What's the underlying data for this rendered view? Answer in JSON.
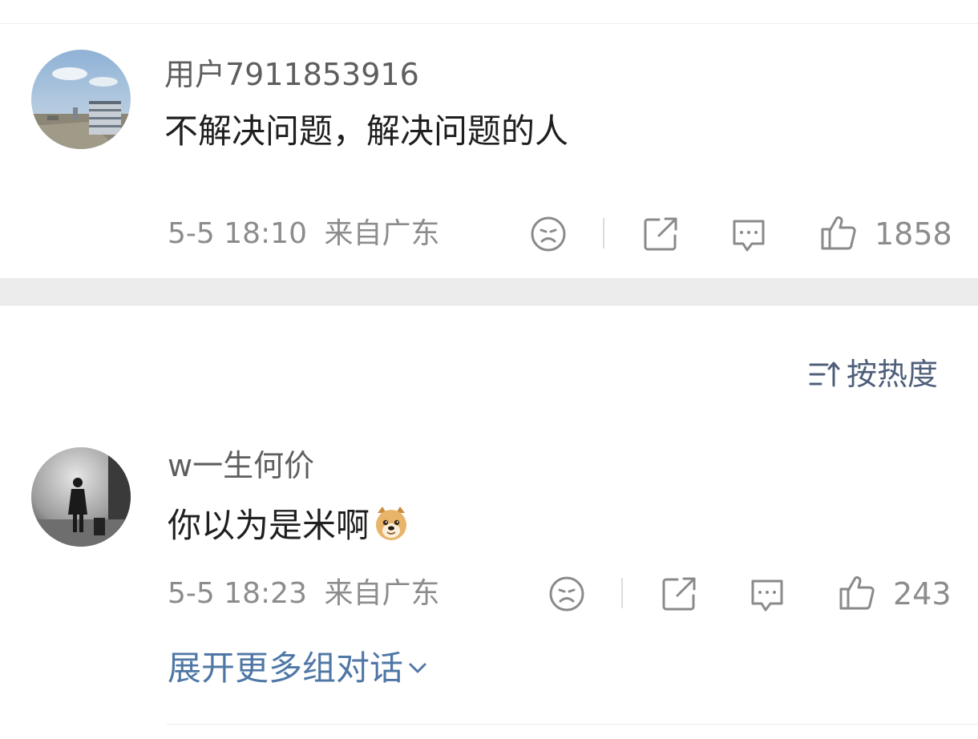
{
  "comments": [
    {
      "username": "用户7911853916",
      "text": "不解决问题，解决问题的人",
      "time": "5-5 18:10",
      "location": "来自广东",
      "likes": "1858"
    },
    {
      "username": "w一生何价",
      "text": "你以为是米啊",
      "emoji": "doge-emoji",
      "time": "5-5 18:23",
      "location": "来自广东",
      "likes": "243"
    }
  ],
  "sort": {
    "label": "按热度",
    "icon": "sort-icon"
  },
  "expand": {
    "label": "展开更多组对话",
    "icon": "chevron-down-icon"
  },
  "colors": {
    "link_blue": "#4f77a6",
    "sort_gray_blue": "#4f5f7a",
    "meta_gray": "#8c8c8c",
    "icon_gray": "#8a8a8a",
    "separator_bar": "#ececec"
  }
}
